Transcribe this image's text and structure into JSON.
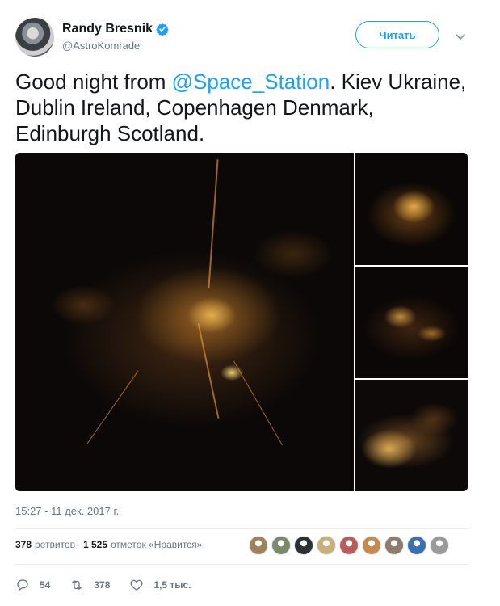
{
  "author": {
    "display_name": "Randy Bresnik",
    "handle": "@AstroKomrade",
    "verified": true
  },
  "follow_button": {
    "label": "Читать"
  },
  "tweet": {
    "text_before": "Good night from ",
    "mention": "@Space_Station",
    "text_after": ". Kiev Ukraine, Dublin Ireland, Copenhagen Denmark, Edinburgh Scotland."
  },
  "media": {
    "photo_count": 4
  },
  "timestamp": "15:27 - 11 дек. 2017 г.",
  "stats": {
    "retweets_count": "378",
    "retweets_label": "ретвитов",
    "likes_count": "1 525",
    "likes_label": "отметок «Нравится»"
  },
  "likers": [
    {
      "color": "#a0825a"
    },
    {
      "color": "#7d8a6a"
    },
    {
      "color": "#2f3033"
    },
    {
      "color": "#c9b07a"
    },
    {
      "color": "#b85c5c"
    },
    {
      "color": "#c58a52"
    },
    {
      "color": "#8f7a6e"
    },
    {
      "color": "#3a6fb0"
    },
    {
      "color": "#9a9a9a"
    }
  ],
  "actions": {
    "reply_count": "54",
    "retweet_count": "378",
    "like_count": "1,5 тыс."
  },
  "colors": {
    "accent": "#1da1f2",
    "text": "#14171a",
    "muted": "#657786"
  },
  "icons": [
    "verified-badge-icon",
    "chevron-down-icon",
    "reply-icon",
    "retweet-icon",
    "heart-icon"
  ]
}
